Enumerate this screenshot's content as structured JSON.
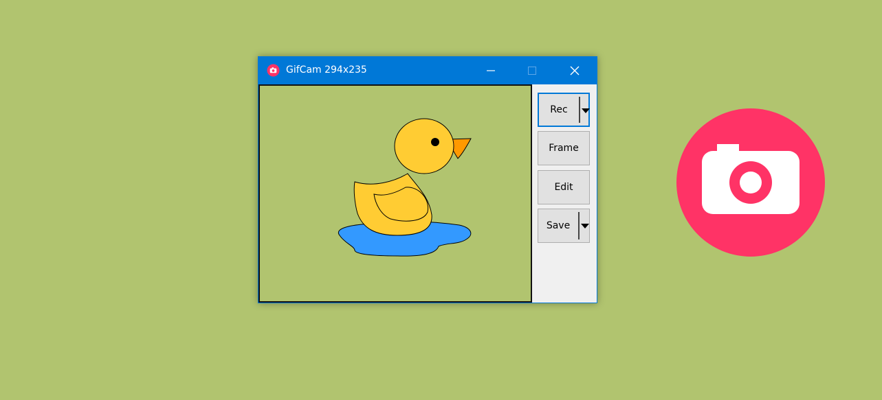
{
  "window": {
    "title": "GifCam 294x235",
    "controls": [
      "minimize",
      "maximize",
      "close"
    ]
  },
  "buttons": {
    "rec": "Rec",
    "frame": "Frame",
    "edit": "Edit",
    "save": "Save"
  },
  "icons": {
    "app": "camera-icon",
    "logo": "camera-icon",
    "capture_content": "rubber-duck-illustration"
  },
  "colors": {
    "background": "#b1c46f",
    "titlebar": "#0078d7",
    "logo_circle": "#ff3366",
    "duck": "#ffcc33",
    "water": "#3399ff",
    "beak": "#ff9900"
  }
}
